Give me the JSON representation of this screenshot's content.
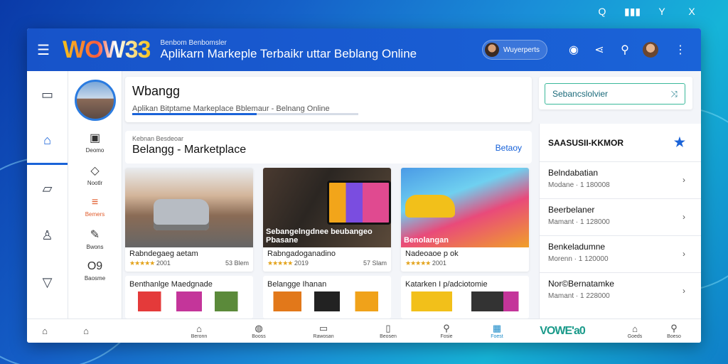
{
  "system_tray": [
    "Q",
    "▮▮▮",
    "Y",
    "X"
  ],
  "topbar": {
    "logo": "WOW33",
    "subtitle": "Benbom Benbomsler",
    "title": "Aplikarn Markeple Terbaikr uttar Beblang Online",
    "user_chip": "Wuyerperts"
  },
  "rail": [
    "menu",
    "home",
    "chat",
    "user",
    "filter"
  ],
  "nav2": {
    "items": [
      {
        "label": "Deomo"
      },
      {
        "label": "Nootlr"
      },
      {
        "label": "Bemers"
      },
      {
        "label": "Bwons"
      },
      {
        "label": "Baosme",
        "big": "O9"
      }
    ]
  },
  "header_card": {
    "title": "Wbangg",
    "subtitle": "Aplikan Bitptame Markeplace Bblemaur - Belnang Online",
    "progress": 0.55
  },
  "section": {
    "small": "Kebnan Besdeoar",
    "title": "Belangg - Marketplace",
    "link": "Betaoy"
  },
  "products": [
    {
      "name": "Rabndegaeg aetam",
      "overlay": "",
      "rating": "2001",
      "location": "53 Blem"
    },
    {
      "name": "Rabngadoganadino",
      "overlay": "Sebangelngdnee beubangeo Pbasane",
      "rating": "2019",
      "location": "57 Slam"
    },
    {
      "name": "Nadeoaoe p ok",
      "overlay": "Benolangan",
      "rating": "2001",
      "location": ""
    }
  ],
  "products2": [
    {
      "name": "Benthanlge Maedgnade"
    },
    {
      "name": "Belangge Ihanan"
    },
    {
      "name": "Katarken I p/adciotomie"
    }
  ],
  "search": {
    "placeholder": "Sebancslolvier"
  },
  "side_panel": {
    "title": "SAASUSII-KKMOR",
    "items": [
      {
        "title": "Belndabatian",
        "sub": "Modane · 1 180008"
      },
      {
        "title": "Beerbelaner",
        "sub": "Mamant · 1 128000"
      },
      {
        "title": "Benkeladumne",
        "sub": "Morenn · 1 120000"
      },
      {
        "title": "Nor©Bernatamke",
        "sub": "Mamant · 1 228000"
      }
    ]
  },
  "bottom_nav": [
    {
      "label": ""
    },
    {
      "label": ""
    },
    {
      "label": "Beronn"
    },
    {
      "label": "Booss"
    },
    {
      "label": "Rawosan"
    },
    {
      "label": "Beosen"
    },
    {
      "label": "Fosie"
    },
    {
      "label": "Foest"
    },
    {
      "label": "VOWE'a0"
    },
    {
      "label": "Goeds"
    },
    {
      "label": "Boeso"
    }
  ]
}
